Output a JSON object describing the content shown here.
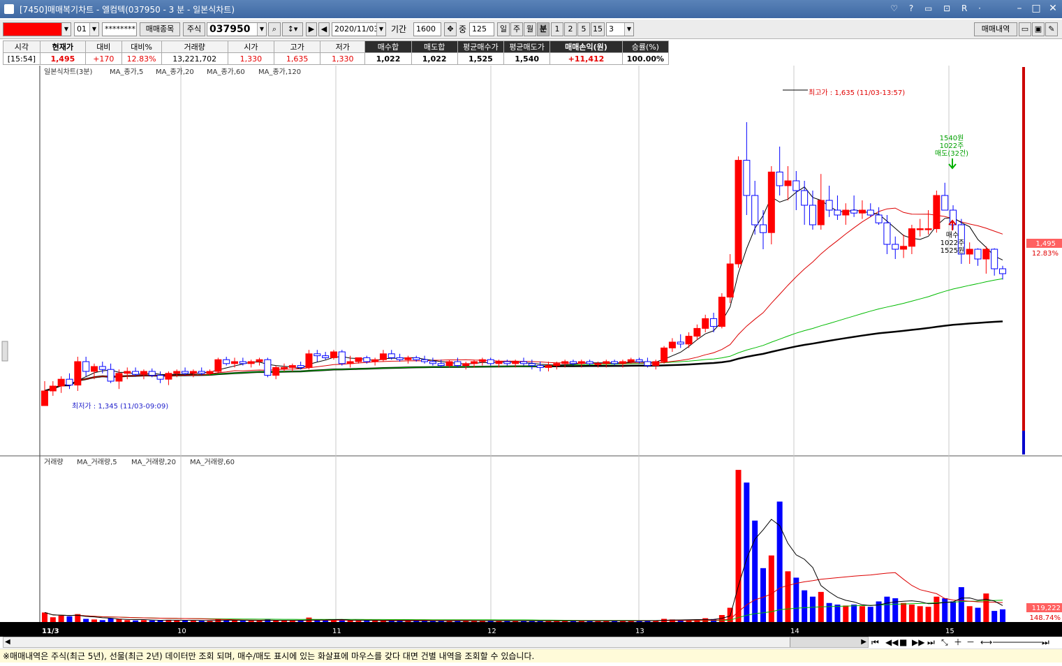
{
  "title": "[7450]매매복기차트 - 엘컴텍(037950 - 3 분 - 일본식차트)",
  "titlebar_icons": "♡ ? ▭ ⊡ R ·",
  "toolbar": {
    "account": "01",
    "password": "********",
    "btn_trade_items": "매매종목",
    "market_type": "주식",
    "code": "037950",
    "date": "2020/11/03",
    "period_label": "기간",
    "period_value": "1600",
    "count_label": "중",
    "count_value": "125",
    "tf_day": "일",
    "tf_week": "주",
    "tf_month": "월",
    "tf_min": "분",
    "tf_1": "1",
    "tf_2": "2",
    "tf_5": "5",
    "tf_15": "15",
    "tf_sel": "3",
    "btn_trade_history": "매매내역"
  },
  "info": {
    "headers": [
      "시각",
      "현재가",
      "대비",
      "대비%",
      "거래량",
      "시가",
      "고가",
      "저가",
      "매수합",
      "매도합",
      "평균매수가",
      "평균매도가",
      "매매손익(원)",
      "승률(%)"
    ],
    "values": [
      "[15:54]",
      "1,495",
      "+170",
      "12.83%",
      "13,221,702",
      "1,330",
      "1,635",
      "1,330",
      "1,022",
      "1,022",
      "1,525",
      "1,540",
      "+11,412",
      "100.00%"
    ]
  },
  "chart": {
    "price_legend": {
      "title": "일본식차트(3분)",
      "items": [
        "MA_종가,5",
        "MA_종가,20",
        "MA_종가,60",
        "MA_종가,120"
      ]
    },
    "volume_legend": {
      "title": "거래량",
      "items": [
        "MA_거래량,5",
        "MA_거래량,20",
        "MA_거래량,60"
      ]
    },
    "high_note": "최고가 : 1,635 (11/03-13:57)",
    "low_note": "최저가 : 1,345 (11/03-09:09)",
    "sell_note": [
      "1540원",
      "1022주",
      "매도(32건)"
    ],
    "buy_note": [
      "매수",
      "1022주",
      "1525원"
    ],
    "price_badge": "1,495",
    "price_pct": "12.83%",
    "vol_badge": "119,222",
    "vol_pct": "148.74%",
    "x_labels": [
      "11/3",
      "10",
      "11",
      "12",
      "13",
      "14",
      "15"
    ],
    "colors": {
      "up": "#ff0000",
      "down": "#0000ff",
      "ma5": "#000000",
      "ma20": "#dd0000",
      "ma60": "#00bb00",
      "ma120": "#000000",
      "grid": "#c8c8c8"
    }
  },
  "chart_data": {
    "type": "candlestick",
    "price": {
      "ylim": [
        1300,
        1680
      ],
      "bars": [
        {
          "o": 1345,
          "h": 1370,
          "l": 1345,
          "c": 1360,
          "v": 30
        },
        {
          "o": 1360,
          "h": 1370,
          "l": 1355,
          "c": 1365,
          "v": 15
        },
        {
          "o": 1365,
          "h": 1375,
          "l": 1358,
          "c": 1372,
          "v": 20
        },
        {
          "o": 1372,
          "h": 1378,
          "l": 1362,
          "c": 1366,
          "v": 18
        },
        {
          "o": 1366,
          "h": 1395,
          "l": 1360,
          "c": 1390,
          "v": 25
        },
        {
          "o": 1390,
          "h": 1395,
          "l": 1375,
          "c": 1380,
          "v": 10
        },
        {
          "o": 1380,
          "h": 1388,
          "l": 1372,
          "c": 1385,
          "v": 8
        },
        {
          "o": 1385,
          "h": 1390,
          "l": 1378,
          "c": 1382,
          "v": 6
        },
        {
          "o": 1382,
          "h": 1388,
          "l": 1368,
          "c": 1370,
          "v": 12
        },
        {
          "o": 1370,
          "h": 1382,
          "l": 1362,
          "c": 1378,
          "v": 10
        },
        {
          "o": 1378,
          "h": 1384,
          "l": 1372,
          "c": 1380,
          "v": 6
        },
        {
          "o": 1380,
          "h": 1384,
          "l": 1375,
          "c": 1377,
          "v": 5
        },
        {
          "o": 1377,
          "h": 1382,
          "l": 1372,
          "c": 1380,
          "v": 6
        },
        {
          "o": 1380,
          "h": 1383,
          "l": 1374,
          "c": 1376,
          "v": 5
        },
        {
          "o": 1376,
          "h": 1380,
          "l": 1368,
          "c": 1372,
          "v": 6
        },
        {
          "o": 1372,
          "h": 1380,
          "l": 1366,
          "c": 1378,
          "v": 7
        },
        {
          "o": 1378,
          "h": 1382,
          "l": 1374,
          "c": 1380,
          "v": 5
        },
        {
          "o": 1380,
          "h": 1384,
          "l": 1376,
          "c": 1378,
          "v": 5
        },
        {
          "o": 1378,
          "h": 1382,
          "l": 1374,
          "c": 1380,
          "v": 4
        },
        {
          "o": 1380,
          "h": 1384,
          "l": 1376,
          "c": 1378,
          "v": 4
        },
        {
          "o": 1378,
          "h": 1382,
          "l": 1376,
          "c": 1380,
          "v": 4
        },
        {
          "o": 1380,
          "h": 1394,
          "l": 1378,
          "c": 1392,
          "v": 8
        },
        {
          "o": 1392,
          "h": 1395,
          "l": 1386,
          "c": 1388,
          "v": 6
        },
        {
          "o": 1388,
          "h": 1394,
          "l": 1384,
          "c": 1390,
          "v": 5
        },
        {
          "o": 1390,
          "h": 1394,
          "l": 1386,
          "c": 1388,
          "v": 4
        },
        {
          "o": 1388,
          "h": 1392,
          "l": 1384,
          "c": 1390,
          "v": 4
        },
        {
          "o": 1390,
          "h": 1394,
          "l": 1386,
          "c": 1392,
          "v": 4
        },
        {
          "o": 1392,
          "h": 1394,
          "l": 1374,
          "c": 1376,
          "v": 9
        },
        {
          "o": 1376,
          "h": 1386,
          "l": 1372,
          "c": 1384,
          "v": 5
        },
        {
          "o": 1384,
          "h": 1388,
          "l": 1380,
          "c": 1384,
          "v": 4
        },
        {
          "o": 1384,
          "h": 1388,
          "l": 1380,
          "c": 1386,
          "v": 4
        },
        {
          "o": 1386,
          "h": 1390,
          "l": 1382,
          "c": 1384,
          "v": 4
        },
        {
          "o": 1384,
          "h": 1402,
          "l": 1382,
          "c": 1398,
          "v": 14
        },
        {
          "o": 1398,
          "h": 1402,
          "l": 1390,
          "c": 1396,
          "v": 6
        },
        {
          "o": 1396,
          "h": 1400,
          "l": 1392,
          "c": 1394,
          "v": 5
        },
        {
          "o": 1394,
          "h": 1402,
          "l": 1392,
          "c": 1400,
          "v": 8
        },
        {
          "o": 1400,
          "h": 1402,
          "l": 1386,
          "c": 1388,
          "v": 7
        },
        {
          "o": 1388,
          "h": 1396,
          "l": 1384,
          "c": 1390,
          "v": 5
        },
        {
          "o": 1390,
          "h": 1394,
          "l": 1388,
          "c": 1394,
          "v": 4
        },
        {
          "o": 1394,
          "h": 1396,
          "l": 1388,
          "c": 1390,
          "v": 4
        },
        {
          "o": 1390,
          "h": 1394,
          "l": 1386,
          "c": 1392,
          "v": 4
        },
        {
          "o": 1392,
          "h": 1402,
          "l": 1390,
          "c": 1398,
          "v": 5
        },
        {
          "o": 1398,
          "h": 1402,
          "l": 1392,
          "c": 1394,
          "v": 4
        },
        {
          "o": 1394,
          "h": 1398,
          "l": 1390,
          "c": 1392,
          "v": 4
        },
        {
          "o": 1392,
          "h": 1396,
          "l": 1388,
          "c": 1394,
          "v": 4
        },
        {
          "o": 1394,
          "h": 1396,
          "l": 1390,
          "c": 1392,
          "v": 4
        },
        {
          "o": 1392,
          "h": 1396,
          "l": 1388,
          "c": 1390,
          "v": 4
        },
        {
          "o": 1390,
          "h": 1394,
          "l": 1386,
          "c": 1388,
          "v": 4
        },
        {
          "o": 1388,
          "h": 1392,
          "l": 1384,
          "c": 1386,
          "v": 4
        },
        {
          "o": 1386,
          "h": 1392,
          "l": 1384,
          "c": 1390,
          "v": 4
        },
        {
          "o": 1390,
          "h": 1394,
          "l": 1384,
          "c": 1386,
          "v": 4
        },
        {
          "o": 1386,
          "h": 1390,
          "l": 1382,
          "c": 1388,
          "v": 4
        },
        {
          "o": 1388,
          "h": 1392,
          "l": 1384,
          "c": 1390,
          "v": 4
        },
        {
          "o": 1390,
          "h": 1394,
          "l": 1386,
          "c": 1392,
          "v": 4
        },
        {
          "o": 1392,
          "h": 1394,
          "l": 1386,
          "c": 1388,
          "v": 4
        },
        {
          "o": 1388,
          "h": 1392,
          "l": 1384,
          "c": 1390,
          "v": 4
        },
        {
          "o": 1390,
          "h": 1392,
          "l": 1386,
          "c": 1388,
          "v": 4
        },
        {
          "o": 1388,
          "h": 1392,
          "l": 1384,
          "c": 1390,
          "v": 4
        },
        {
          "o": 1390,
          "h": 1394,
          "l": 1386,
          "c": 1388,
          "v": 4
        },
        {
          "o": 1388,
          "h": 1392,
          "l": 1382,
          "c": 1386,
          "v": 4
        },
        {
          "o": 1386,
          "h": 1390,
          "l": 1380,
          "c": 1384,
          "v": 4
        },
        {
          "o": 1384,
          "h": 1390,
          "l": 1380,
          "c": 1386,
          "v": 4
        },
        {
          "o": 1386,
          "h": 1390,
          "l": 1382,
          "c": 1388,
          "v": 4
        },
        {
          "o": 1388,
          "h": 1392,
          "l": 1384,
          "c": 1390,
          "v": 4
        },
        {
          "o": 1390,
          "h": 1392,
          "l": 1386,
          "c": 1388,
          "v": 4
        },
        {
          "o": 1388,
          "h": 1392,
          "l": 1384,
          "c": 1390,
          "v": 4
        },
        {
          "o": 1390,
          "h": 1392,
          "l": 1386,
          "c": 1388,
          "v": 4
        },
        {
          "o": 1388,
          "h": 1390,
          "l": 1384,
          "c": 1388,
          "v": 4
        },
        {
          "o": 1388,
          "h": 1392,
          "l": 1384,
          "c": 1390,
          "v": 4
        },
        {
          "o": 1390,
          "h": 1392,
          "l": 1386,
          "c": 1388,
          "v": 4
        },
        {
          "o": 1388,
          "h": 1392,
          "l": 1384,
          "c": 1390,
          "v": 4
        },
        {
          "o": 1390,
          "h": 1394,
          "l": 1388,
          "c": 1392,
          "v": 4
        },
        {
          "o": 1392,
          "h": 1394,
          "l": 1388,
          "c": 1390,
          "v": 4
        },
        {
          "o": 1390,
          "h": 1394,
          "l": 1384,
          "c": 1386,
          "v": 5
        },
        {
          "o": 1386,
          "h": 1392,
          "l": 1382,
          "c": 1390,
          "v": 5
        },
        {
          "o": 1390,
          "h": 1406,
          "l": 1388,
          "c": 1404,
          "v": 10
        },
        {
          "o": 1404,
          "h": 1414,
          "l": 1400,
          "c": 1410,
          "v": 8
        },
        {
          "o": 1410,
          "h": 1418,
          "l": 1404,
          "c": 1408,
          "v": 5
        },
        {
          "o": 1408,
          "h": 1420,
          "l": 1404,
          "c": 1416,
          "v": 7
        },
        {
          "o": 1416,
          "h": 1428,
          "l": 1412,
          "c": 1424,
          "v": 8
        },
        {
          "o": 1424,
          "h": 1438,
          "l": 1420,
          "c": 1434,
          "v": 12
        },
        {
          "o": 1434,
          "h": 1440,
          "l": 1420,
          "c": 1426,
          "v": 9
        },
        {
          "o": 1426,
          "h": 1460,
          "l": 1424,
          "c": 1456,
          "v": 22
        },
        {
          "o": 1456,
          "h": 1500,
          "l": 1450,
          "c": 1490,
          "v": 45
        },
        {
          "o": 1490,
          "h": 1600,
          "l": 1486,
          "c": 1596,
          "v": 480
        },
        {
          "o": 1596,
          "h": 1635,
          "l": 1540,
          "c": 1560,
          "v": 440
        },
        {
          "o": 1560,
          "h": 1575,
          "l": 1520,
          "c": 1530,
          "v": 320
        },
        {
          "o": 1530,
          "h": 1545,
          "l": 1505,
          "c": 1522,
          "v": 170
        },
        {
          "o": 1522,
          "h": 1590,
          "l": 1510,
          "c": 1584,
          "v": 210
        },
        {
          "o": 1584,
          "h": 1610,
          "l": 1560,
          "c": 1570,
          "v": 380
        },
        {
          "o": 1570,
          "h": 1590,
          "l": 1555,
          "c": 1575,
          "v": 160
        },
        {
          "o": 1575,
          "h": 1585,
          "l": 1545,
          "c": 1565,
          "v": 140
        },
        {
          "o": 1565,
          "h": 1575,
          "l": 1530,
          "c": 1550,
          "v": 100
        },
        {
          "o": 1550,
          "h": 1565,
          "l": 1525,
          "c": 1530,
          "v": 80
        },
        {
          "o": 1530,
          "h": 1582,
          "l": 1525,
          "c": 1555,
          "v": 95
        },
        {
          "o": 1555,
          "h": 1570,
          "l": 1538,
          "c": 1545,
          "v": 60
        },
        {
          "o": 1545,
          "h": 1560,
          "l": 1535,
          "c": 1540,
          "v": 55
        },
        {
          "o": 1540,
          "h": 1552,
          "l": 1530,
          "c": 1545,
          "v": 52
        },
        {
          "o": 1545,
          "h": 1560,
          "l": 1538,
          "c": 1542,
          "v": 55
        },
        {
          "o": 1542,
          "h": 1555,
          "l": 1536,
          "c": 1545,
          "v": 50
        },
        {
          "o": 1545,
          "h": 1552,
          "l": 1538,
          "c": 1540,
          "v": 48
        },
        {
          "o": 1540,
          "h": 1548,
          "l": 1530,
          "c": 1532,
          "v": 65
        },
        {
          "o": 1532,
          "h": 1540,
          "l": 1500,
          "c": 1510,
          "v": 80
        },
        {
          "o": 1510,
          "h": 1518,
          "l": 1495,
          "c": 1505,
          "v": 75
        },
        {
          "o": 1505,
          "h": 1520,
          "l": 1496,
          "c": 1508,
          "v": 60
        },
        {
          "o": 1508,
          "h": 1530,
          "l": 1500,
          "c": 1526,
          "v": 55
        },
        {
          "o": 1526,
          "h": 1536,
          "l": 1518,
          "c": 1526,
          "v": 50
        },
        {
          "o": 1526,
          "h": 1545,
          "l": 1520,
          "c": 1526,
          "v": 48
        },
        {
          "o": 1526,
          "h": 1565,
          "l": 1522,
          "c": 1560,
          "v": 80
        },
        {
          "o": 1560,
          "h": 1573,
          "l": 1550,
          "c": 1545,
          "v": 75
        },
        {
          "o": 1545,
          "h": 1550,
          "l": 1525,
          "c": 1530,
          "v": 65
        },
        {
          "o": 1530,
          "h": 1536,
          "l": 1490,
          "c": 1500,
          "v": 110
        },
        {
          "o": 1500,
          "h": 1512,
          "l": 1490,
          "c": 1505,
          "v": 50
        },
        {
          "o": 1505,
          "h": 1506,
          "l": 1488,
          "c": 1495,
          "v": 45
        },
        {
          "o": 1495,
          "h": 1508,
          "l": 1480,
          "c": 1505,
          "v": 90
        },
        {
          "o": 1505,
          "h": 1506,
          "l": 1478,
          "c": 1485,
          "v": 35
        },
        {
          "o": 1485,
          "h": 1488,
          "l": 1474,
          "c": 1480,
          "v": 40
        }
      ]
    }
  }
}
